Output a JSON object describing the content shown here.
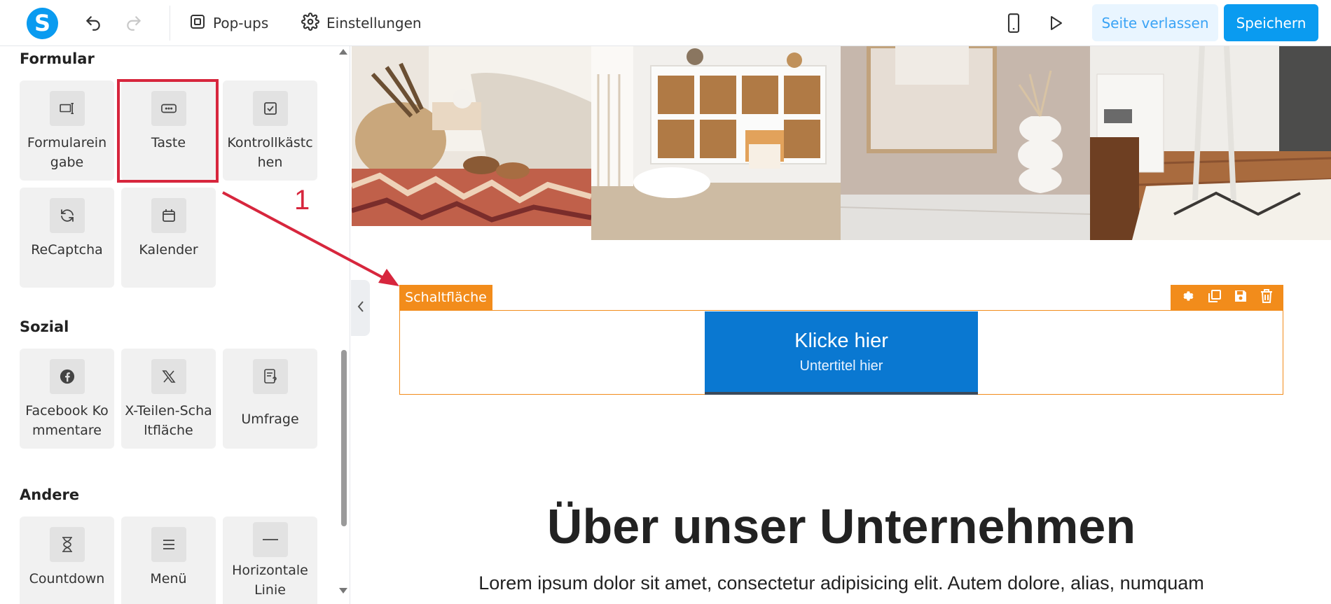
{
  "topbar": {
    "logo_letter": "S",
    "popups_label": "Pop-ups",
    "settings_label": "Einstellungen",
    "leave_label": "Seite verlassen",
    "save_label": "Speichern"
  },
  "sidebar": {
    "sections": [
      {
        "title": "Formular",
        "items": [
          {
            "label": "Formulareingabe",
            "icon": "form-input-icon"
          },
          {
            "label": "Taste",
            "icon": "button-icon"
          },
          {
            "label": "Kontrollkästchen",
            "icon": "checkbox-icon"
          },
          {
            "label": "ReCaptcha",
            "icon": "refresh-icon"
          },
          {
            "label": "Kalender",
            "icon": "calendar-icon"
          }
        ]
      },
      {
        "title": "Sozial",
        "items": [
          {
            "label": "Facebook Kommentare",
            "icon": "facebook-icon"
          },
          {
            "label": "X-Teilen-Schaltfläche",
            "icon": "x-logo-icon"
          },
          {
            "label": "Umfrage",
            "icon": "survey-icon"
          }
        ]
      },
      {
        "title": "Andere",
        "items": [
          {
            "label": "Countdown",
            "icon": "hourglass-icon"
          },
          {
            "label": "Menü",
            "icon": "menu-icon"
          },
          {
            "label": "Horizontale Linie",
            "icon": "horizontal-line-icon"
          }
        ]
      }
    ]
  },
  "annotation": {
    "number": "1"
  },
  "canvas": {
    "component_tag": "Schaltfläche",
    "cta_title": "Klicke hier",
    "cta_subtitle": "Untertitel hier",
    "about_heading": "Über unser Unternehmen",
    "about_text": "Lorem ipsum dolor sit amet, consectetur adipisicing elit. Autem dolore, alias, numquam"
  },
  "colors": {
    "accent": "#0a9bf0",
    "component_orange": "#f28c1b",
    "cta_blue": "#0a78d1",
    "annotation_red": "#d7263d"
  }
}
